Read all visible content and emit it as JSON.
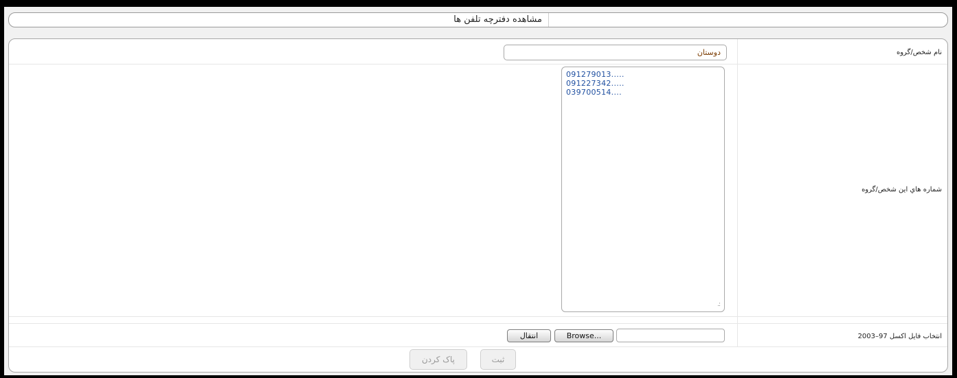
{
  "window": {
    "title": "مشاهده دفترچه تلفن ها"
  },
  "form": {
    "name_label": "نام شخص/گروه",
    "name_value": "دوستان",
    "numbers_label": "شماره هاي  اين شخص/گروه",
    "numbers": [
      "091279013.....",
      "091227342.....",
      "039700514...."
    ],
    "excel_label": "2003–97 انتخاب فايل اكسل",
    "browse_label": "Browse...",
    "transfer_label": "انتقال",
    "submit_label": "ثبت",
    "clear_label": "پاک کردن"
  }
}
